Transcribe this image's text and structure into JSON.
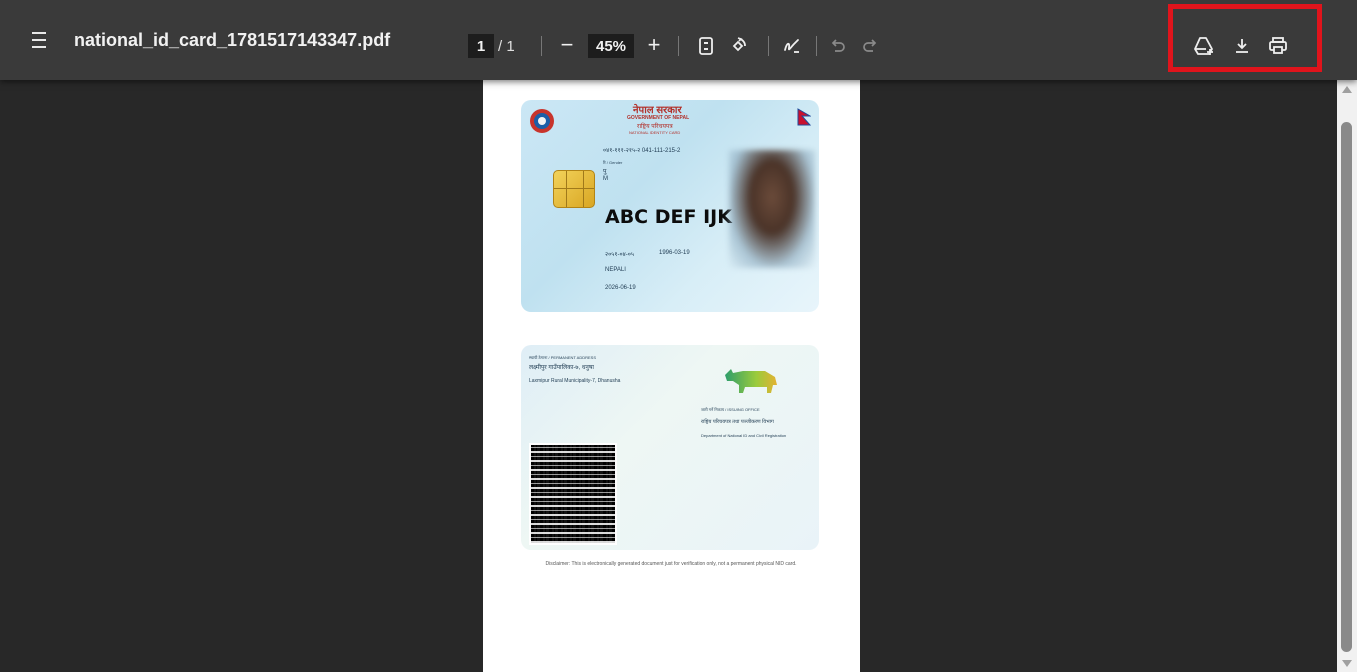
{
  "toolbar": {
    "menu_icon": "hamburger-menu-icon",
    "filename": "national_id_card_1781517143347.pdf",
    "page_current": "1",
    "page_total": "/ 1",
    "zoom_out": "−",
    "zoom_level": "45%",
    "zoom_in": "+",
    "icons": [
      "fit-page-icon",
      "rotate-icon",
      "draw-icon",
      "undo-icon",
      "redo-icon",
      "save-to-drive-icon",
      "download-icon",
      "print-icon"
    ]
  },
  "highlight_color": "#e0141c",
  "document": {
    "front": {
      "header_np": "नेपाल सरकार",
      "header_en": "GOVERNMENT OF NEPAL",
      "subheader_np": "राष्ट्रिय परिचयपत्र",
      "subheader_en": "NATIONAL IDENTITY CARD",
      "nin": "०४१-१११-२१५-२  041-111-215-2",
      "field_label_1": "रि / Gender",
      "field_val_1": "पु",
      "field_val_2": "M",
      "holder_name": "ABC DEF IJK",
      "dob_np": "२०५१-०४-०५",
      "dob_en": "1996-03-19",
      "nationality": "NEPALI",
      "issue_date": "2026-06-19"
    },
    "back": {
      "address_label": "स्थायी ठेगाना / PERMANENT ADDRESS",
      "address_np": "लक्ष्मीपुर गाउँपालिका-७, धनुषा",
      "address_en": "Laxmipur Rural Municipality-7, Dhanusha",
      "office_label": "जारी गर्ने निकाय / ISSUING OFFICE",
      "office_np": "राष्ट्रिय परिचयपत्र तथा पञ्जीकरण विभाग",
      "office_en": "Department of National ID and Civil Registration"
    },
    "disclaimer": "Disclaimer: This is electronically generated document just for verification only, not a permanent physical NID card."
  }
}
